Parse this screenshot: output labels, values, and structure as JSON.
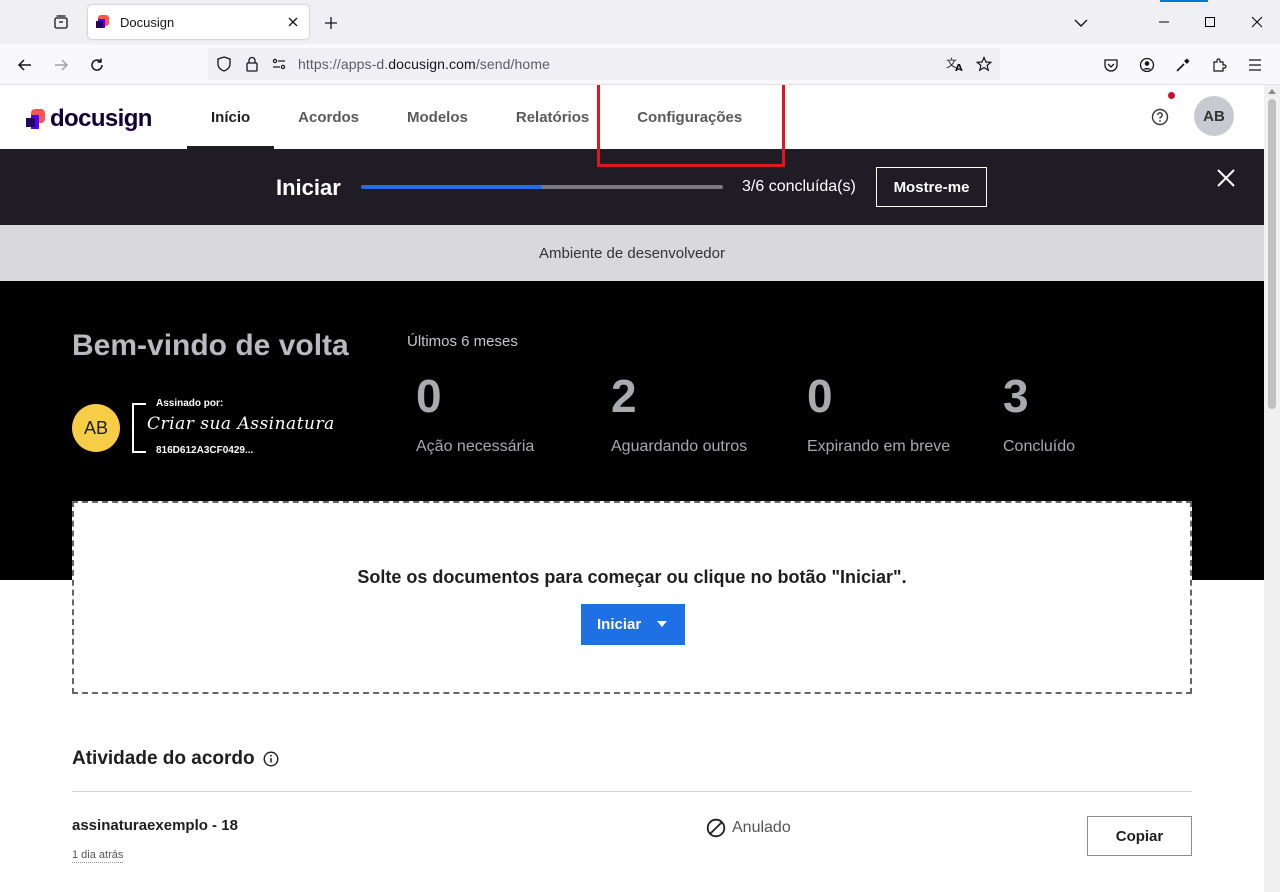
{
  "browser": {
    "tab_title": "Docusign",
    "url_prefix": "https://apps-d.",
    "url_domain": "docusign.com",
    "url_path": "/send/home"
  },
  "header": {
    "logo_text": "docusign",
    "nav": [
      {
        "label": "Início",
        "active": true
      },
      {
        "label": "Acordos",
        "active": false
      },
      {
        "label": "Modelos",
        "active": false
      },
      {
        "label": "Relatórios",
        "active": false
      },
      {
        "label": "Configurações",
        "active": false
      }
    ],
    "avatar_initials": "AB"
  },
  "banner": {
    "title": "Iniciar",
    "progress_fraction": 0.5,
    "progress_label": "3/6 concluída(s)",
    "show_me_label": "Mostre-me"
  },
  "dev_bar": {
    "text": "Ambiente de desenvolvedor"
  },
  "hero": {
    "welcome": "Bem-vindo de volta",
    "avatar_initials": "AB",
    "signature": {
      "signed_by": "Assinado por:",
      "name": "Criar sua Assinatura",
      "id": "816D612A3CF0429..."
    },
    "period": "Últimos 6 meses",
    "stats": [
      {
        "value": "0",
        "label": "Ação necessária"
      },
      {
        "value": "2",
        "label": "Aguardando outros"
      },
      {
        "value": "0",
        "label": "Expirando em breve"
      },
      {
        "value": "3",
        "label": "Concluído"
      }
    ]
  },
  "dropzone": {
    "text": "Solte os documentos para começar ou clique no botão \"Iniciar\".",
    "button_label": "Iniciar"
  },
  "activity": {
    "title": "Atividade do acordo",
    "rows": [
      {
        "name": "assinaturaexemplo - 18",
        "time": "1 dia atrás",
        "status": "Anulado",
        "action": "Copiar"
      }
    ]
  },
  "colors": {
    "accent_blue": "#1f6fe5",
    "banner_bg": "#1f1c26",
    "highlight_red": "#e0161e",
    "avatar_yellow": "#f7cc47"
  }
}
